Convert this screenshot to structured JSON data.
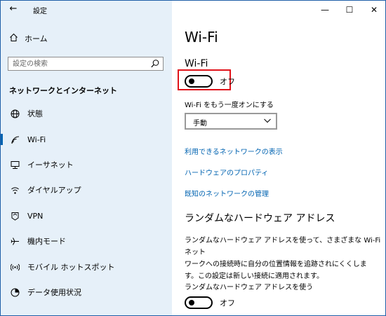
{
  "window": {
    "title": "設定",
    "back_glyph": "←",
    "minimize_glyph": "—",
    "maximize_glyph": "☐",
    "close_glyph": "✕"
  },
  "sidebar": {
    "home": {
      "icon": "home-icon",
      "label": "ホーム"
    },
    "search": {
      "placeholder": "設定の検索",
      "icon": "search-icon"
    },
    "section_title": "ネットワークとインターネット",
    "items": [
      {
        "icon": "globe-icon",
        "label": "状態"
      },
      {
        "icon": "wifi-icon",
        "label": "Wi-Fi",
        "active": true
      },
      {
        "icon": "ethernet-icon",
        "label": "イーサネット"
      },
      {
        "icon": "dialup-icon",
        "label": "ダイヤルアップ"
      },
      {
        "icon": "vpn-icon",
        "label": "VPN"
      },
      {
        "icon": "airplane-icon",
        "label": "機内モード"
      },
      {
        "icon": "hotspot-icon",
        "label": "モバイル ホットスポット"
      },
      {
        "icon": "data-usage-icon",
        "label": "データ使用状況"
      }
    ]
  },
  "main": {
    "page_title": "Wi-Fi",
    "wifi_heading": "Wi-Fi",
    "wifi_toggle": {
      "state": "オフ",
      "on": false
    },
    "reenable_label": "Wi-Fi をもう一度オンにする",
    "reenable_select": {
      "value": "手動"
    },
    "links": [
      "利用できるネットワークの表示",
      "ハードウェアのプロパティ",
      "既知のネットワークの管理"
    ],
    "random_hw_heading": "ランダムなハードウェア アドレス",
    "random_hw_paragraph_lines": [
      "ランダムなハードウェア アドレスを使って、さまざまな Wi-Fi ネット",
      "ワークへの接続時に自分の位置情報を追跡されにくくしま",
      "す。この設定は新しい接続に適用されます。"
    ],
    "random_hw_use_label": "ランダムなハードウェア アドレスを使う",
    "random_hw_toggle": {
      "state": "オフ",
      "on": false
    }
  },
  "colors": {
    "accent": "#0063b1",
    "highlight_box": "#e0131a",
    "sidebar_bg": "#e6f0f9"
  }
}
